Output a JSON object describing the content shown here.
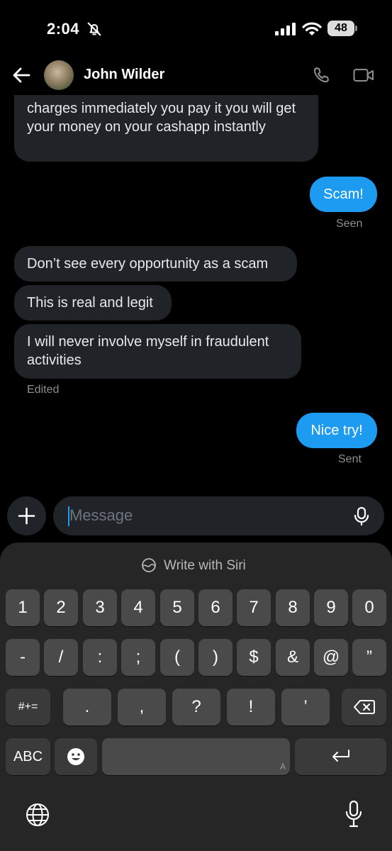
{
  "status_bar": {
    "time": "2:04",
    "battery": "48"
  },
  "header": {
    "contact_name": "John Wilder"
  },
  "messages": [
    {
      "direction": "received",
      "text": "charges immediately you pay it you will get your money on your cashapp instantly"
    },
    {
      "direction": "sent",
      "text": "Scam!"
    },
    {
      "direction": "received",
      "text": "Don’t see every opportunity as a scam"
    },
    {
      "direction": "received",
      "text": "This is real and legit"
    },
    {
      "direction": "received",
      "text": "I will never involve myself in fraudulent activities"
    },
    {
      "direction": "sent",
      "text": "Nice try!"
    }
  ],
  "meta": {
    "seen": "Seen",
    "edited": "Edited",
    "sent": "Sent"
  },
  "composer": {
    "placeholder": "Message"
  },
  "keyboard": {
    "siri_label": "Write with Siri",
    "row1": [
      "1",
      "2",
      "3",
      "4",
      "5",
      "6",
      "7",
      "8",
      "9",
      "0"
    ],
    "row2": [
      "-",
      "/",
      ":",
      ";",
      "(",
      ")",
      "$",
      "&",
      "@",
      "”"
    ],
    "row3_left": "#+=",
    "row3": [
      ".",
      ",",
      "?",
      "!",
      "’"
    ],
    "abc_label": "ABC",
    "space_hint": "A"
  },
  "colors": {
    "accent": "#1d9bf0",
    "bubble_received": "#202327",
    "keyboard_bg": "#262626"
  }
}
